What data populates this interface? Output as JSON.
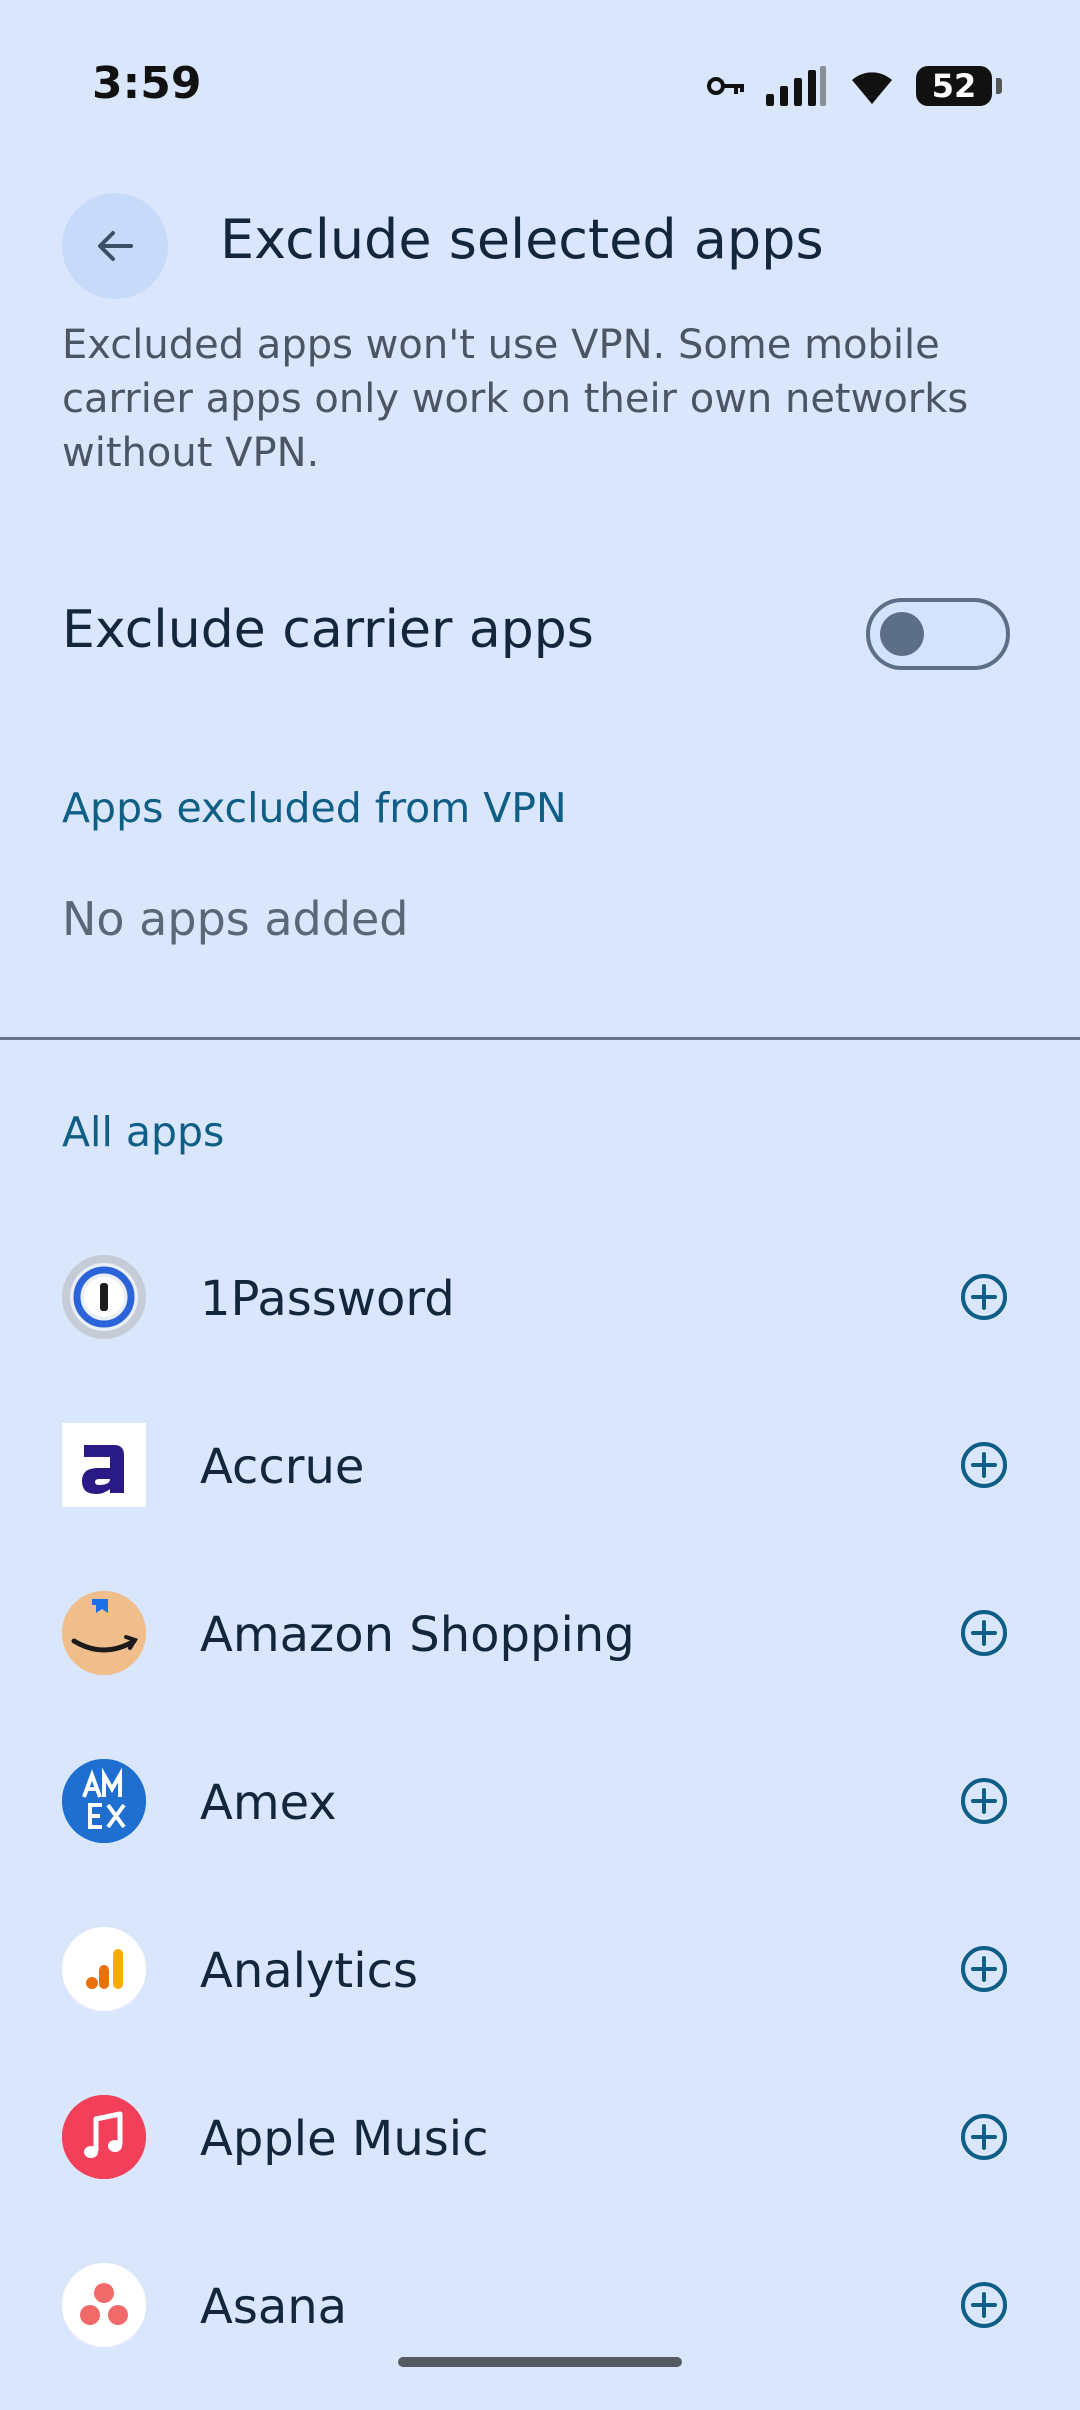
{
  "status_bar": {
    "time": "3:59",
    "battery": "52",
    "icons": [
      "vpn-key-icon",
      "cellular-signal-icon",
      "wifi-icon",
      "battery-icon"
    ]
  },
  "header": {
    "title": "Exclude selected apps",
    "back_icon": "arrow-left-icon",
    "description": "Excluded apps won't use VPN. Some mobile carrier apps only work on their own networks without VPN."
  },
  "carrier_toggle": {
    "label": "Exclude carrier apps",
    "checked": false
  },
  "excluded_section": {
    "heading": "Apps excluded from VPN",
    "empty_text": "No apps added"
  },
  "all_apps": {
    "heading": "All apps",
    "items": [
      {
        "name": "1Password",
        "icon": "1password-icon",
        "action_icon": "add-circle-icon"
      },
      {
        "name": "Accrue",
        "icon": "accrue-icon",
        "action_icon": "add-circle-icon"
      },
      {
        "name": "Amazon Shopping",
        "icon": "amazon-shopping-icon",
        "action_icon": "add-circle-icon"
      },
      {
        "name": "Amex",
        "icon": "amex-icon",
        "action_icon": "add-circle-icon"
      },
      {
        "name": "Analytics",
        "icon": "analytics-icon",
        "action_icon": "add-circle-icon"
      },
      {
        "name": "Apple Music",
        "icon": "apple-music-icon",
        "action_icon": "add-circle-icon"
      },
      {
        "name": "Asana",
        "icon": "asana-icon",
        "action_icon": "add-circle-icon"
      }
    ]
  },
  "colors": {
    "background": "#dae6fb",
    "accent": "#0e5e86",
    "title": "#14263d"
  }
}
